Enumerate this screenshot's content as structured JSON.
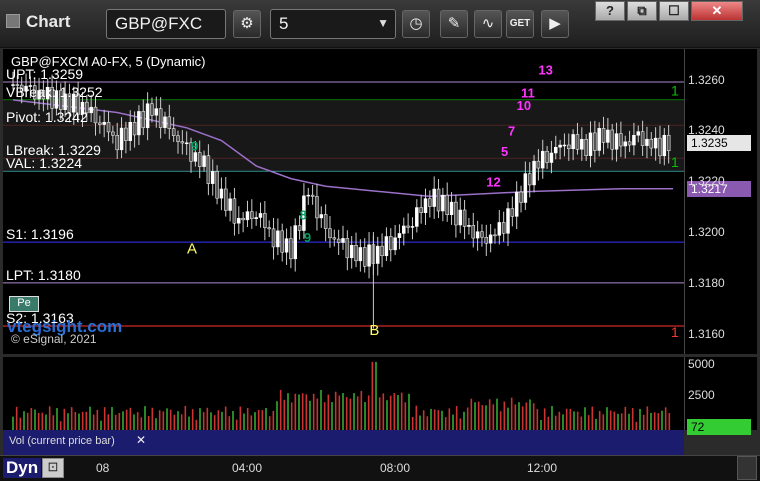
{
  "window": {
    "title": "Chart",
    "symbol": "GBP@FXC",
    "interval": "5",
    "controls": [
      "?",
      "⧉",
      "☐",
      "✕"
    ]
  },
  "toolbar": {
    "tools": [
      {
        "name": "settings-icon",
        "glyph": "⚙"
      },
      {
        "name": "clock-icon",
        "glyph": "◷"
      },
      {
        "name": "pencil-icon",
        "glyph": "✎"
      },
      {
        "name": "study-icon",
        "glyph": "∿"
      },
      {
        "name": "get-icon",
        "glyph": "GET"
      },
      {
        "name": "play-icon",
        "glyph": "▶"
      }
    ]
  },
  "chart": {
    "title": "GBP@FXCM A0-FX, 5 (Dynamic)",
    "levels": [
      {
        "label": "UPT: 1.3259",
        "price": 1.3259,
        "color": "#b088d0"
      },
      {
        "label": "VBreak: 1.3252",
        "price": 1.3252,
        "color": "#00c000"
      },
      {
        "label": "Pivot: 1.3242",
        "price": 1.3242,
        "color": "#ff3333"
      },
      {
        "label": "LBreak: 1.3229",
        "price": 1.3229,
        "color": "#ff3333"
      },
      {
        "label": "VAL: 1.3224",
        "price": 1.3224,
        "color": "#44dddd"
      },
      {
        "label": "S1: 1.3196",
        "price": 1.3196,
        "color": "#3333ff"
      },
      {
        "label": "LPT: 1.3180",
        "price": 1.318,
        "color": "#b088d0"
      },
      {
        "label": "S2: 1.3163",
        "price": 1.3163,
        "color": "#ff3333"
      }
    ],
    "watermark": "© eSignal, 2021",
    "watermark_url": "vtegsight.com",
    "pe_badge": "Pe",
    "points": [
      {
        "label": "A",
        "x_min": 205,
        "price": 1.3197
      },
      {
        "label": "B",
        "x_min": 415,
        "price": 1.3165
      }
    ],
    "last_price": "1.3235",
    "ma_price": "1.3217",
    "right_marks": [
      {
        "text": "1",
        "price": 1.3256,
        "color": "#00c000"
      },
      {
        "text": "1",
        "price": 1.3228,
        "color": "#00c000"
      },
      {
        "text": "1",
        "price": 1.3161,
        "color": "#ff3333"
      }
    ]
  },
  "chart_data": {
    "type": "candlestick",
    "title": "GBP@FXCM A0-FX, 5 (Dynamic)",
    "ylim": [
      1.3152,
      1.3272
    ],
    "y_ticks": [
      "1.3260",
      "1.3240",
      "1.3220",
      "1.3200",
      "1.3180",
      "1.3160"
    ],
    "x_ticks": [
      "08",
      "04:00",
      "08:00",
      "12:00"
    ],
    "close_path": [
      [
        0,
        1.3258
      ],
      [
        20,
        1.3255
      ],
      [
        40,
        1.3253
      ],
      [
        60,
        1.3251
      ],
      [
        80,
        1.325
      ],
      [
        100,
        1.3244
      ],
      [
        120,
        1.3236
      ],
      [
        140,
        1.3242
      ],
      [
        160,
        1.3248
      ],
      [
        180,
        1.324
      ],
      [
        200,
        1.3232
      ],
      [
        220,
        1.3226
      ],
      [
        240,
        1.3214
      ],
      [
        260,
        1.3205
      ],
      [
        280,
        1.3208
      ],
      [
        300,
        1.3198
      ],
      [
        320,
        1.3193
      ],
      [
        340,
        1.3216
      ],
      [
        360,
        1.32
      ],
      [
        380,
        1.3194
      ],
      [
        400,
        1.319
      ],
      [
        420,
        1.3192
      ],
      [
        440,
        1.3198
      ],
      [
        460,
        1.3205
      ],
      [
        480,
        1.3214
      ],
      [
        500,
        1.321
      ],
      [
        520,
        1.3203
      ],
      [
        540,
        1.3196
      ],
      [
        560,
        1.32
      ],
      [
        580,
        1.3212
      ],
      [
        600,
        1.3226
      ],
      [
        620,
        1.3232
      ],
      [
        640,
        1.3236
      ],
      [
        660,
        1.3234
      ],
      [
        680,
        1.3238
      ],
      [
        700,
        1.3234
      ],
      [
        720,
        1.3237
      ],
      [
        740,
        1.3233
      ],
      [
        760,
        1.3236
      ]
    ],
    "ma_path": [
      [
        0,
        1.3252
      ],
      [
        120,
        1.3247
      ],
      [
        200,
        1.3241
      ],
      [
        240,
        1.3236
      ],
      [
        280,
        1.3226
      ],
      [
        320,
        1.3221
      ],
      [
        360,
        1.3218
      ],
      [
        420,
        1.3216
      ],
      [
        480,
        1.3214
      ],
      [
        540,
        1.3215
      ],
      [
        600,
        1.3216
      ],
      [
        700,
        1.3217
      ],
      [
        760,
        1.3217
      ]
    ],
    "volume": {
      "ticks": [
        "5000",
        "2500"
      ],
      "last": "72",
      "ylim": [
        0,
        6000
      ]
    }
  },
  "volume_pane": {
    "label": "Vol (current price bar)",
    "close": "✕"
  },
  "statusbar": {
    "mode": "Dyn"
  }
}
